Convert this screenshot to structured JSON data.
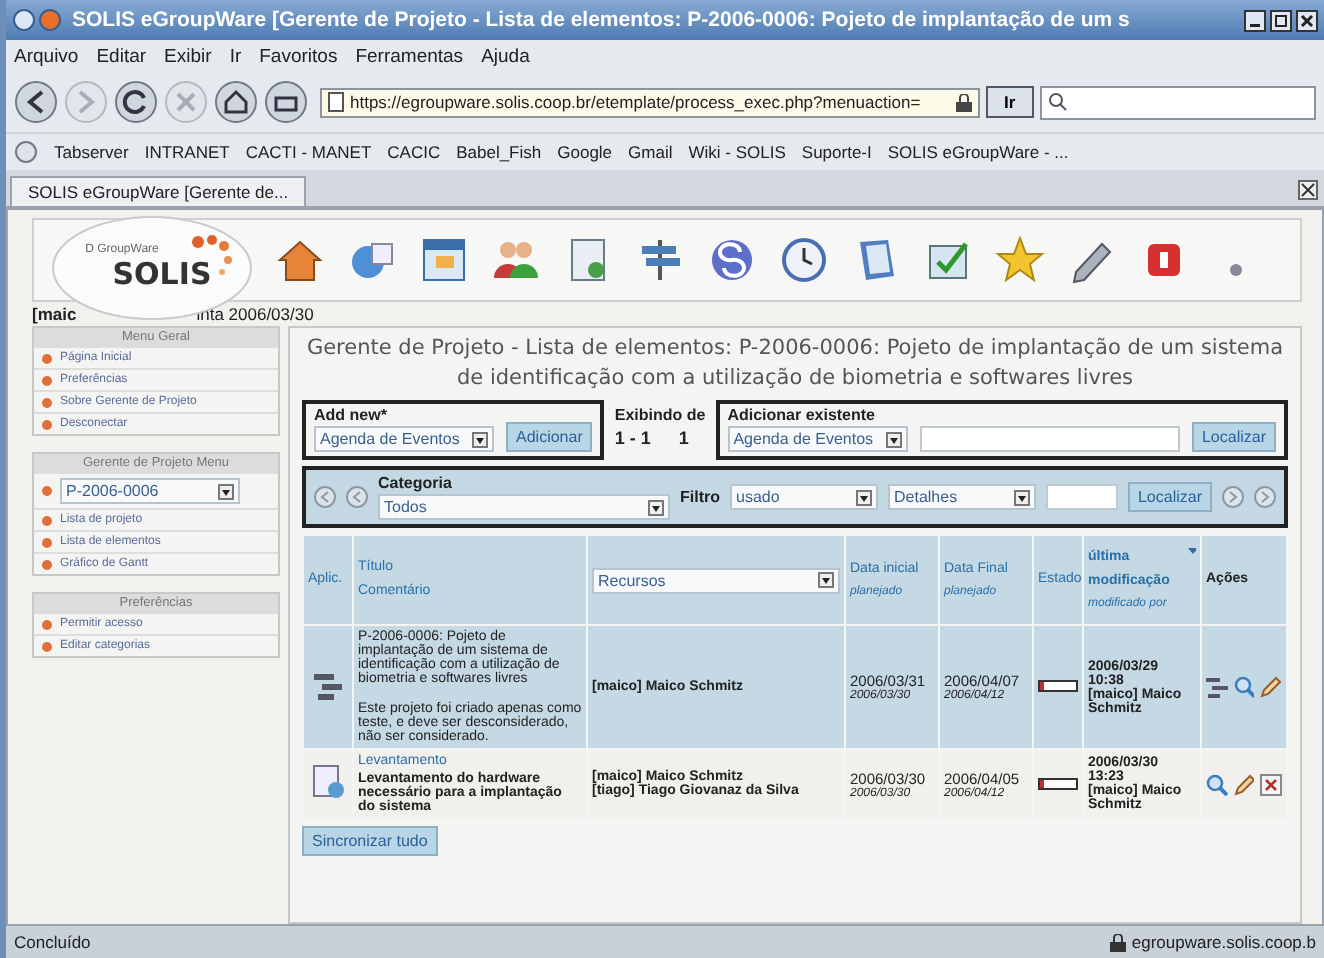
{
  "window": {
    "title": "SOLIS eGroupWare [Gerente de Projeto - Lista de elementos: P-2006-0006: Pojeto de implantação de um s"
  },
  "menu": [
    "Arquivo",
    "Editar",
    "Exibir",
    "Ir",
    "Favoritos",
    "Ferramentas",
    "Ajuda"
  ],
  "address_bar": {
    "url": "https://egroupware.solis.coop.br/etemplate/process_exec.php?menuaction=",
    "go": "Ir"
  },
  "bookmarks": [
    "Tabserver",
    "INTRANET",
    "CACTI - MANET",
    "CACIC",
    "Babel_Fish",
    "Google",
    "Gmail",
    "Wiki - SOLIS",
    "Suporte-I",
    "SOLIS eGroupWare - ..."
  ],
  "tabs": [
    {
      "label": "SOLIS eGroupWare [Gerente de...",
      "selected": true
    }
  ],
  "logo": {
    "caption": "D GroupWare",
    "name": "SOLIS"
  },
  "user_line": [
    "[maic",
    "inta 2006/03/30"
  ],
  "sidebar": [
    {
      "title": "Menu Geral",
      "items": [
        "Página Inicial",
        "Preferências",
        "Sobre Gerente de Projeto",
        "Desconectar"
      ]
    },
    {
      "title": "Gerente de Projeto Menu",
      "select": "P-2006-0006",
      "items": [
        "Lista de projeto",
        "Lista de elementos",
        "Gráfico de Gantt"
      ]
    },
    {
      "title": "Preferências",
      "items": [
        "Permitir acesso",
        "Editar categorias"
      ]
    }
  ],
  "page": {
    "title": "Gerente de Projeto - Lista de elementos: P-2006-0006: Pojeto de implantação de um sistema de identificação com a utilização de biometria e softwares livres",
    "add_new": {
      "label": "Add new*",
      "value": "Agenda de Eventos",
      "button": "Adicionar"
    },
    "showing": {
      "label": "Exibindo de",
      "range": "1 - 1",
      "total": "1"
    },
    "add_existing": {
      "label": "Adicionar existente",
      "value": "Agenda de Eventos",
      "button": "Localizar"
    },
    "filters": {
      "category_label": "Categoria",
      "category": "Todos",
      "filter_label": "Filtro",
      "filter": "usado",
      "details": "Detalhes",
      "button": "Localizar"
    },
    "table": {
      "columns": [
        {
          "kind": "text",
          "label": "Aplic.",
          "bold": false
        },
        {
          "kind": "text",
          "label": "Título",
          "sub": "Comentário",
          "bold": false
        },
        {
          "kind": "select",
          "label": "Recursos"
        },
        {
          "kind": "text",
          "label": "Data inicial",
          "sub": "planejado",
          "bold": false
        },
        {
          "kind": "text",
          "label": "Data Final",
          "sub": "planejado",
          "bold": false
        },
        {
          "kind": "text",
          "label": "Estado",
          "bold": false
        },
        {
          "kind": "sort",
          "label": "última modificação",
          "sub": "modificado por",
          "bold": true
        },
        {
          "kind": "text",
          "label": "Ações",
          "bold": true
        }
      ],
      "rows": [
        {
          "kind": "project",
          "selected": true,
          "title": "P-2006-0006: Pojeto de implantação de um sistema de identificação com a utilização de biometria e softwares livres",
          "comment": "Este projeto foi criado apenas como teste, e deve ser desconsiderado, não ser considerado.",
          "resources": [
            "[maico] Maico Schmitz"
          ],
          "start": "2006/03/31",
          "start_planned": "2006/03/30",
          "end": "2006/04/07",
          "end_planned": "2006/04/12",
          "level": 0.1,
          "modified": "2006/03/29 10:38",
          "modified_by": "[maico] Maico Schmitz",
          "actions": [
            {
              "kind": "gantt"
            },
            {
              "kind": "view"
            },
            {
              "kind": "edit"
            }
          ]
        },
        {
          "kind": "task",
          "selected": false,
          "title": "Levantamento",
          "comment": "Levantamento do hardware necessário para a implantação do sistema",
          "resources": [
            "[maico] Maico Schmitz",
            "[tiago] Tiago Giovanaz da Silva"
          ],
          "start": "2006/03/30",
          "start_planned": "2006/03/30",
          "end": "2006/04/05",
          "end_planned": "2006/04/12",
          "level": 0.1,
          "modified": "2006/03/30 13:23",
          "modified_by": "[maico] Maico Schmitz",
          "actions": [
            {
              "kind": "view"
            },
            {
              "kind": "edit"
            },
            {
              "kind": "delete"
            }
          ]
        }
      ]
    },
    "sync_button": "Sincronizar tudo"
  },
  "status_bar": {
    "text": "Concluído",
    "host": "egroupware.solis.coop.b"
  }
}
